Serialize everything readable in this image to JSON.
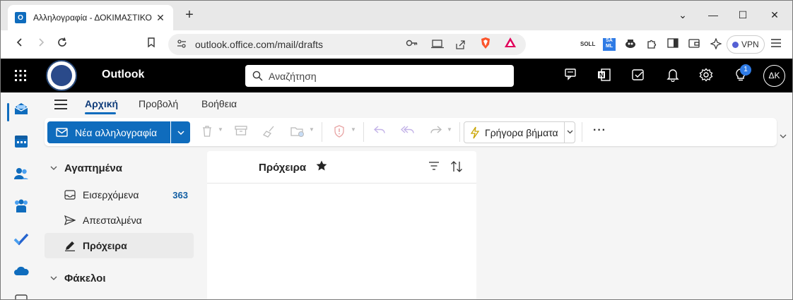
{
  "browser": {
    "tab_title": "Αλληλογραφία - ΔΟΚΙΜΑΣΤΙΚΟ",
    "tab_favicon": "O",
    "new_tab": "+",
    "url": "outlook.office.com/mail/drafts",
    "vpn_label": "VPN",
    "ext_soll": "SOLL",
    "ext_saml": "SA ML"
  },
  "header": {
    "app_name": "Outlook",
    "search_placeholder": "Αναζήτηση",
    "notification_count": "1",
    "avatar_initials": "ΔΚ"
  },
  "ribbon": {
    "tabs": [
      {
        "label": "Αρχική",
        "active": true
      },
      {
        "label": "Προβολή",
        "active": false
      },
      {
        "label": "Βοήθεια",
        "active": false
      }
    ],
    "new_mail_label": "Νέα αλληλογραφία",
    "quick_steps_label": "Γρήγορα βήματα",
    "more_label": "···"
  },
  "folders": {
    "favorites_label": "Αγαπημένα",
    "items": [
      {
        "label": "Εισερχόμενα",
        "count": "363",
        "icon": "inbox-icon"
      },
      {
        "label": "Απεσταλμένα",
        "count": "",
        "icon": "send-icon"
      },
      {
        "label": "Πρόχειρα",
        "count": "",
        "icon": "drafts-icon",
        "selected": true
      }
    ],
    "folders_label": "Φάκελοι"
  },
  "message_list": {
    "title": "Πρόχειρα"
  },
  "colors": {
    "accent": "#0f6cbd",
    "header_bg": "#000000",
    "count_color": "#115ea3"
  }
}
